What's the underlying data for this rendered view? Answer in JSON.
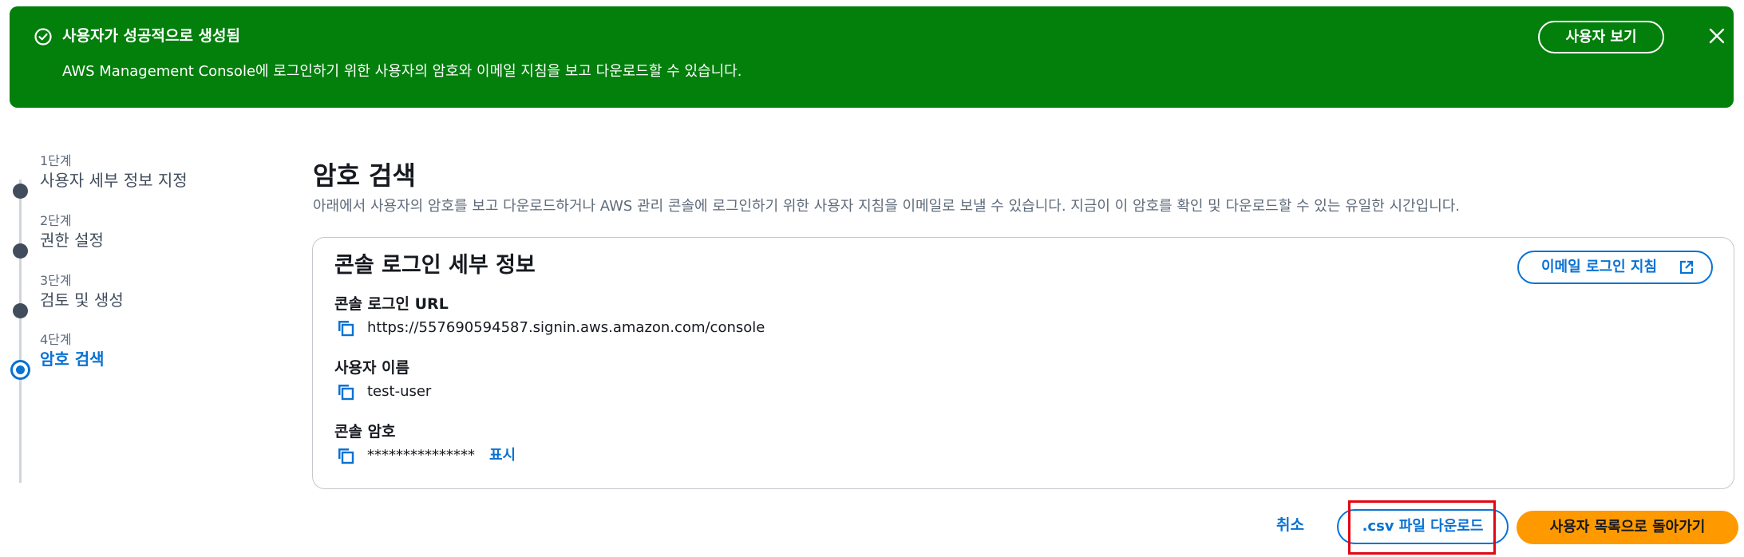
{
  "banner": {
    "title": "사용자가 성공적으로 생성됨",
    "description": "AWS Management Console에 로그인하기 위한 사용자의 암호와 이메일 지침을 보고 다운로드할 수 있습니다.",
    "view_user_button": "사용자 보기",
    "icon": "check-circle-icon",
    "close_icon": "close-icon",
    "color": "#037f0c"
  },
  "steps": [
    {
      "number": "1단계",
      "label": "사용자 세부 정보 지정"
    },
    {
      "number": "2단계",
      "label": "권한 설정"
    },
    {
      "number": "3단계",
      "label": "검토 및 생성"
    },
    {
      "number": "4단계",
      "label": "암호 검색",
      "active": true
    }
  ],
  "main": {
    "title": "암호 검색",
    "description": "아래에서 사용자의 암호를 보고 다운로드하거나 AWS 관리 콘솔에 로그인하기 위한 사용자 지침을 이메일로 보낼 수 있습니다. 지금이 이 암호를 확인 및 다운로드할 수 있는 유일한 시간입니다."
  },
  "card": {
    "title": "콘솔 로그인 세부 정보",
    "email_button": "이메일 로그인 지침",
    "fields": {
      "url": {
        "label": "콘솔 로그인 URL",
        "value": "https://557690594587.signin.aws.amazon.com/console"
      },
      "username": {
        "label": "사용자 이름",
        "value": "test-user"
      },
      "password": {
        "label": "콘솔 암호",
        "value": "***************",
        "show_label": "표시"
      }
    }
  },
  "footer": {
    "cancel": "취소",
    "csv_download": ".csv 파일 다운로드",
    "back_to_list": "사용자 목록으로 돌아가기"
  },
  "colors": {
    "accent": "#0972d3",
    "primary_button": "#ff9900",
    "highlight": "#e30613"
  }
}
